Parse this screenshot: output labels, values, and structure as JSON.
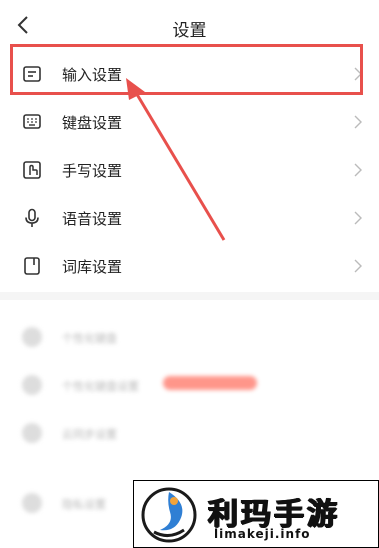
{
  "header": {
    "title": "设置"
  },
  "settings": [
    {
      "label": "输入设置",
      "icon": "input-settings-icon"
    },
    {
      "label": "键盘设置",
      "icon": "keyboard-icon"
    },
    {
      "label": "手写设置",
      "icon": "handwriting-icon"
    },
    {
      "label": "语音设置",
      "icon": "microphone-icon"
    },
    {
      "label": "词库设置",
      "icon": "dictionary-icon"
    }
  ],
  "blurred_rows": [
    {
      "text": "个性化键盘"
    },
    {
      "text": "个性化键盘设置"
    },
    {
      "text": "云同步设置"
    },
    {
      "text": "隐私设置"
    }
  ],
  "colors": {
    "highlight": "#e8504c",
    "badge": "#ff6a5a"
  },
  "watermark": {
    "main": "利玛手游",
    "sub": "limakeji.info"
  }
}
